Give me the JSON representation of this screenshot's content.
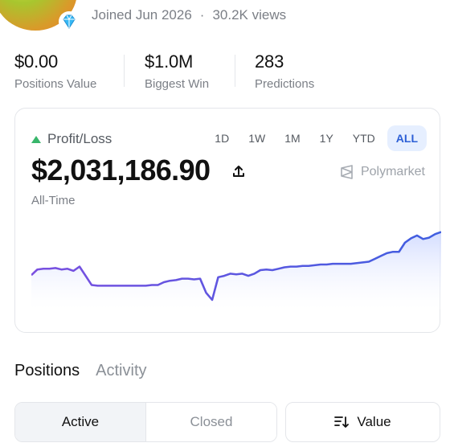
{
  "profile": {
    "joined": "Joined Jun 2026",
    "separator": "·",
    "views": "30.2K views",
    "badge_icon": "diamond-icon"
  },
  "stats": [
    {
      "value": "$0.00",
      "label": "Positions Value"
    },
    {
      "value": "$1.0M",
      "label": "Biggest Win"
    },
    {
      "value": "283",
      "label": "Predictions"
    }
  ],
  "pnl": {
    "label": "Profit/Loss",
    "trend_icon": "triangle-up-icon",
    "amount": "$2,031,186.90",
    "period": "All-Time",
    "brand": "Polymarket",
    "ranges": [
      "1D",
      "1W",
      "1M",
      "1Y",
      "YTD",
      "ALL"
    ],
    "active_range": "ALL",
    "colors": {
      "line": "#5b4fe0",
      "fill_top": "#cfd9ff",
      "positive": "#38b66b"
    }
  },
  "chart_data": {
    "type": "area",
    "values": [
      0.35,
      0.43,
      0.44,
      0.44,
      0.45,
      0.43,
      0.44,
      0.41,
      0.47,
      0.34,
      0.21,
      0.2,
      0.2,
      0.2,
      0.2,
      0.2,
      0.2,
      0.2,
      0.2,
      0.2,
      0.21,
      0.21,
      0.25,
      0.27,
      0.28,
      0.3,
      0.3,
      0.29,
      0.3,
      0.1,
      0.0,
      0.32,
      0.34,
      0.37,
      0.36,
      0.37,
      0.34,
      0.37,
      0.42,
      0.43,
      0.42,
      0.44,
      0.46,
      0.47,
      0.47,
      0.48,
      0.48,
      0.49,
      0.5,
      0.5,
      0.51,
      0.51,
      0.51,
      0.51,
      0.52,
      0.53,
      0.54,
      0.58,
      0.62,
      0.66,
      0.68,
      0.68,
      0.81,
      0.87,
      0.91,
      0.86,
      0.88,
      0.93,
      0.96
    ]
  },
  "tabs": [
    "Positions",
    "Activity"
  ],
  "filter": {
    "active": "Active",
    "closed": "Closed",
    "sort_label": "Value",
    "sort_icon": "sort-icon"
  }
}
